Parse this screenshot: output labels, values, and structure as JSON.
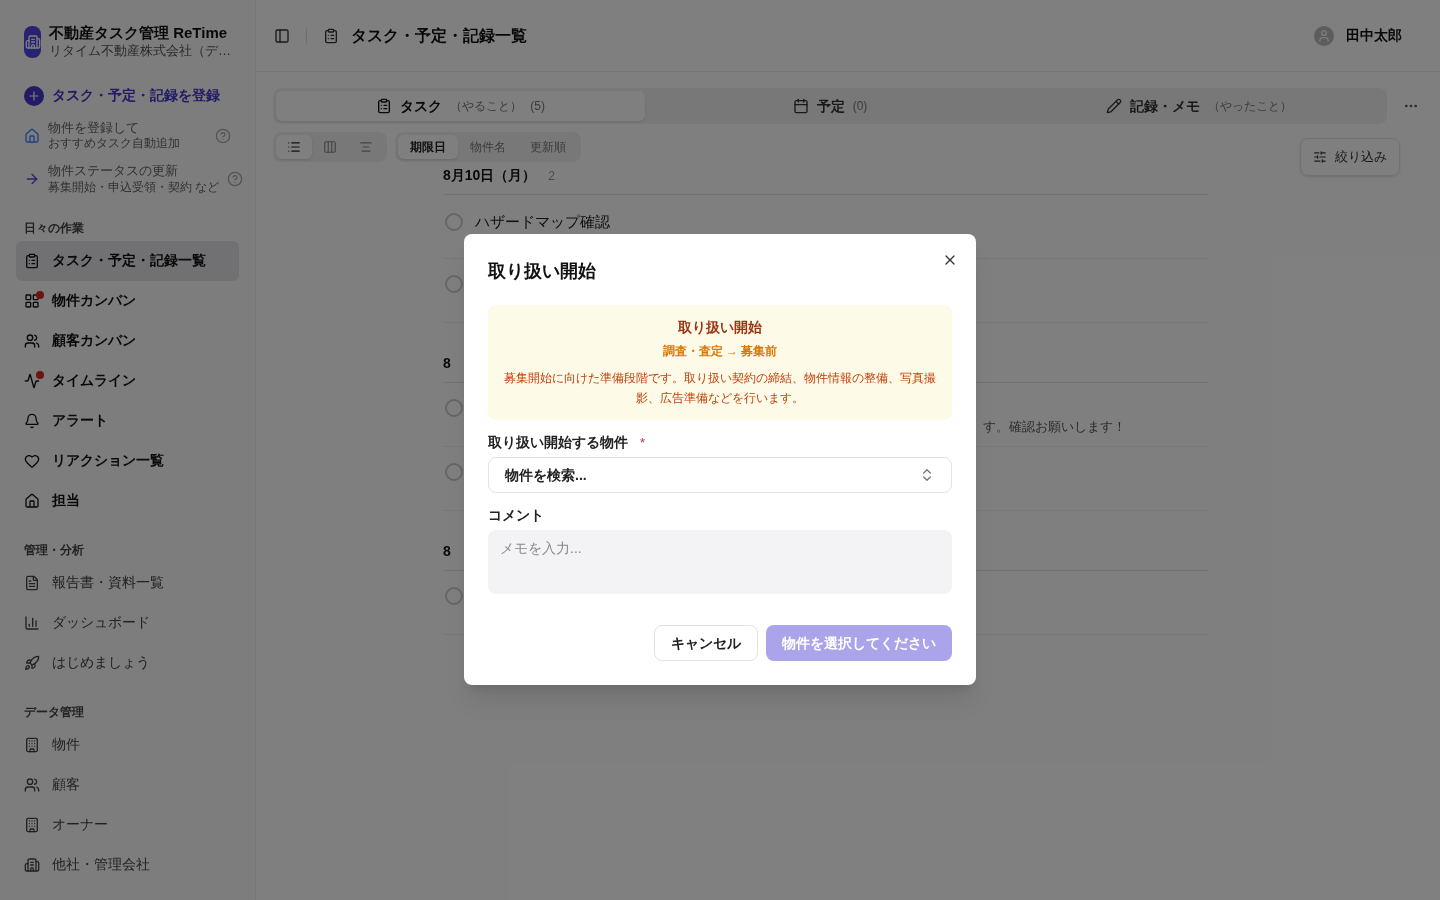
{
  "app": {
    "name": "不動産タスク管理 ReTime",
    "company": "リタイム不動産株式会社（デ…"
  },
  "sidebar": {
    "actions": [
      {
        "kind": "primary",
        "label": "タスク・予定・記録を登録"
      },
      {
        "kind": "guide",
        "label": "物件を登録して",
        "sub": "おすすめタスク自動追加"
      },
      {
        "kind": "guide",
        "label": "物件ステータスの更新",
        "sub": "募集開始・申込受領・契約 など"
      }
    ],
    "sections": [
      {
        "title": "日々の作業",
        "items": [
          {
            "label": "タスク・予定・記録一覧",
            "selected": true,
            "badge": false
          },
          {
            "label": "物件カンバン",
            "selected": false,
            "badge": true
          },
          {
            "label": "顧客カンバン",
            "selected": false,
            "badge": false
          },
          {
            "label": "タイムライン",
            "selected": false,
            "badge": true
          },
          {
            "label": "アラート",
            "selected": false,
            "badge": false
          },
          {
            "label": "リアクション一覧",
            "selected": false,
            "badge": false
          },
          {
            "label": "担当",
            "selected": false,
            "badge": false
          }
        ]
      },
      {
        "title": "管理・分析",
        "items": [
          {
            "label": "報告書・資料一覧",
            "selected": false,
            "badge": false
          },
          {
            "label": "ダッシュボード",
            "selected": false,
            "badge": false
          },
          {
            "label": "はじめましょう",
            "selected": false,
            "badge": false
          }
        ]
      },
      {
        "title": "データ管理",
        "items": [
          {
            "label": "物件",
            "selected": false,
            "badge": false
          },
          {
            "label": "顧客",
            "selected": false,
            "badge": false
          },
          {
            "label": "オーナー",
            "selected": false,
            "badge": false
          },
          {
            "label": "他社・管理会社",
            "selected": false,
            "badge": false
          }
        ]
      }
    ]
  },
  "header": {
    "title": "タスク・予定・記録一覧",
    "user": "田中太郎"
  },
  "tabs": [
    {
      "label": "タスク",
      "note": "（やること）",
      "count": "(5)",
      "selected": true
    },
    {
      "label": "予定",
      "count": "(0)",
      "selected": false
    },
    {
      "label": "記録・メモ",
      "note": "（やったこと）",
      "selected": false
    }
  ],
  "view_modes": [
    {
      "selected": true
    },
    {
      "selected": false
    },
    {
      "selected": false
    }
  ],
  "sort": [
    {
      "label": "期限日",
      "selected": true
    },
    {
      "label": "物件名",
      "selected": false
    },
    {
      "label": "更新順",
      "selected": false
    }
  ],
  "filter_button": "絞り込み",
  "list": [
    {
      "kind": "group",
      "date": "8月10日（月）",
      "count": "2"
    },
    {
      "kind": "task",
      "title": "ハザードマップ確認",
      "checked": false
    },
    {
      "kind": "task",
      "checked": false
    },
    {
      "kind": "group",
      "date": "8"
    },
    {
      "kind": "task",
      "note": "す。確認お願いします！",
      "checked": false
    },
    {
      "kind": "task",
      "checked": false
    },
    {
      "kind": "group",
      "date": "8"
    },
    {
      "kind": "task",
      "checked": false
    }
  ],
  "modal": {
    "title": "取り扱い開始",
    "info": {
      "title": "取り扱い開始",
      "flow": "調査・査定 → 募集前",
      "description": "募集開始に向けた準備段階です。取り扱い契約の締結、物件情報の整備、写真撮影、広告準備などを行います。"
    },
    "property_field": {
      "label": "取り扱い開始する物件",
      "required": true,
      "required_mark": "*",
      "placeholder": "物件を検索..."
    },
    "comment_field": {
      "label": "コメント",
      "placeholder": "メモを入力..."
    },
    "cancel": "キャンセル",
    "submit": {
      "label": "物件を選択してください",
      "disabled": true
    }
  }
}
